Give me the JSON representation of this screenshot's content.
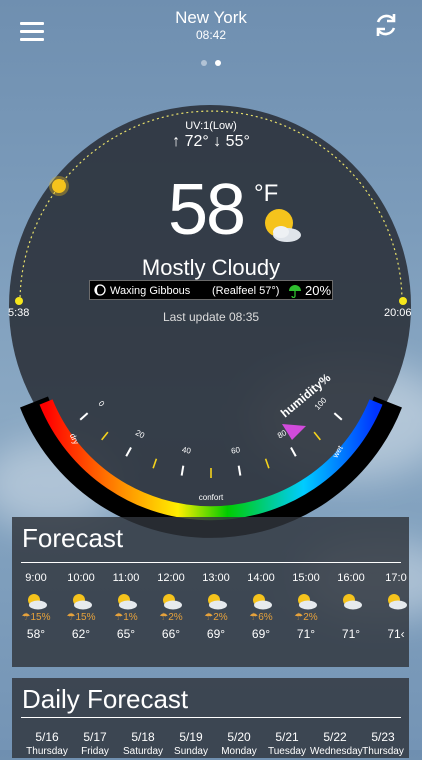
{
  "header": {
    "city": "New York",
    "time": "08:42"
  },
  "pager": {
    "pages": 2,
    "active": 1
  },
  "current": {
    "uv": "UV:1(Low)",
    "high": "72°",
    "low": "55°",
    "temperature": "58",
    "unit": "°F",
    "condition": "Mostly Cloudy",
    "moon_phase": "Waxing Gibbous",
    "realfeel": "(Realfeel 57°)",
    "precip_chance": "20%",
    "last_update": "Last update 08:35",
    "sunrise": "5:38",
    "sunset": "20:06"
  },
  "humidity_gauge": {
    "label": "humidity%",
    "ticks": [
      "0",
      "20",
      "40",
      "60",
      "80",
      "100"
    ],
    "zones": [
      "dry",
      "confort",
      "wet"
    ],
    "value": 80,
    "colors": [
      "#ff0000",
      "#ff8800",
      "#ffee00",
      "#00cc00",
      "#00ccff",
      "#0033ff"
    ]
  },
  "forecast": {
    "title": "Forecast",
    "hours": [
      {
        "time": "9:00",
        "pop": "15%",
        "temp": "58°"
      },
      {
        "time": "10:00",
        "pop": "15%",
        "temp": "62°"
      },
      {
        "time": "11:00",
        "pop": "1%",
        "temp": "65°"
      },
      {
        "time": "12:00",
        "pop": "2%",
        "temp": "66°"
      },
      {
        "time": "13:00",
        "pop": "2%",
        "temp": "69°"
      },
      {
        "time": "14:00",
        "pop": "6%",
        "temp": "69°"
      },
      {
        "time": "15:00",
        "pop": "2%",
        "temp": "71°"
      },
      {
        "time": "16:00",
        "pop": "",
        "temp": "71°"
      },
      {
        "time": "17:0",
        "pop": "",
        "temp": "71‹"
      }
    ]
  },
  "daily": {
    "title": "Daily Forecast",
    "days": [
      {
        "date": "5/16",
        "name": "Thursday"
      },
      {
        "date": "5/17",
        "name": "Friday"
      },
      {
        "date": "5/18",
        "name": "Saturday"
      },
      {
        "date": "5/19",
        "name": "Sunday"
      },
      {
        "date": "5/20",
        "name": "Monday"
      },
      {
        "date": "5/21",
        "name": "Tuesday"
      },
      {
        "date": "5/22",
        "name": "Wednesday"
      },
      {
        "date": "5/23",
        "name": "Thursday"
      }
    ]
  },
  "colors": {
    "accent_orange": "#e6a23c",
    "sun_yellow": "#f5d31c"
  }
}
